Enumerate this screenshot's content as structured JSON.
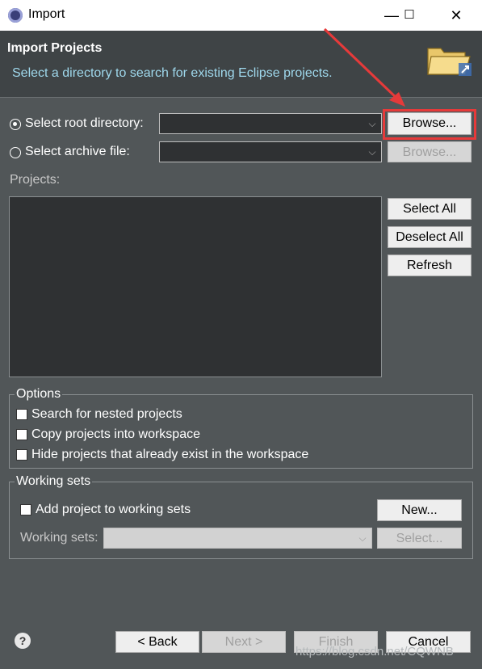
{
  "window": {
    "title": "Import"
  },
  "controls": {
    "minimize": "—",
    "maximize": "☐",
    "close": "✕"
  },
  "header": {
    "title": "Import Projects",
    "subtitle": "Select a directory to search for existing Eclipse projects."
  },
  "source": {
    "root_label": "Select root directory:",
    "archive_label": "Select archive file:",
    "root_value": "",
    "archive_value": "",
    "browse_label": "Browse...",
    "browse_disabled_label": "Browse..."
  },
  "projects": {
    "label": "Projects:",
    "select_all": "Select All",
    "deselect_all": "Deselect All",
    "refresh": "Refresh"
  },
  "options": {
    "legend": "Options",
    "search_nested": "Search for nested projects",
    "copy_projects": "Copy projects into workspace",
    "hide_existing": "Hide projects that already exist in the workspace"
  },
  "working_sets": {
    "legend": "Working sets",
    "add_label": "Add project to working sets",
    "new_button": "New...",
    "sets_label": "Working sets:",
    "select_button": "Select..."
  },
  "footer": {
    "help_icon": "?",
    "back": "< Back",
    "next": "Next >",
    "finish": "Finish",
    "cancel": "Cancel",
    "watermark": "https://blog.csdn.net/CQWNB"
  },
  "colors": {
    "annotation": "#e63a3a",
    "subtitle": "#9fd8ec"
  }
}
